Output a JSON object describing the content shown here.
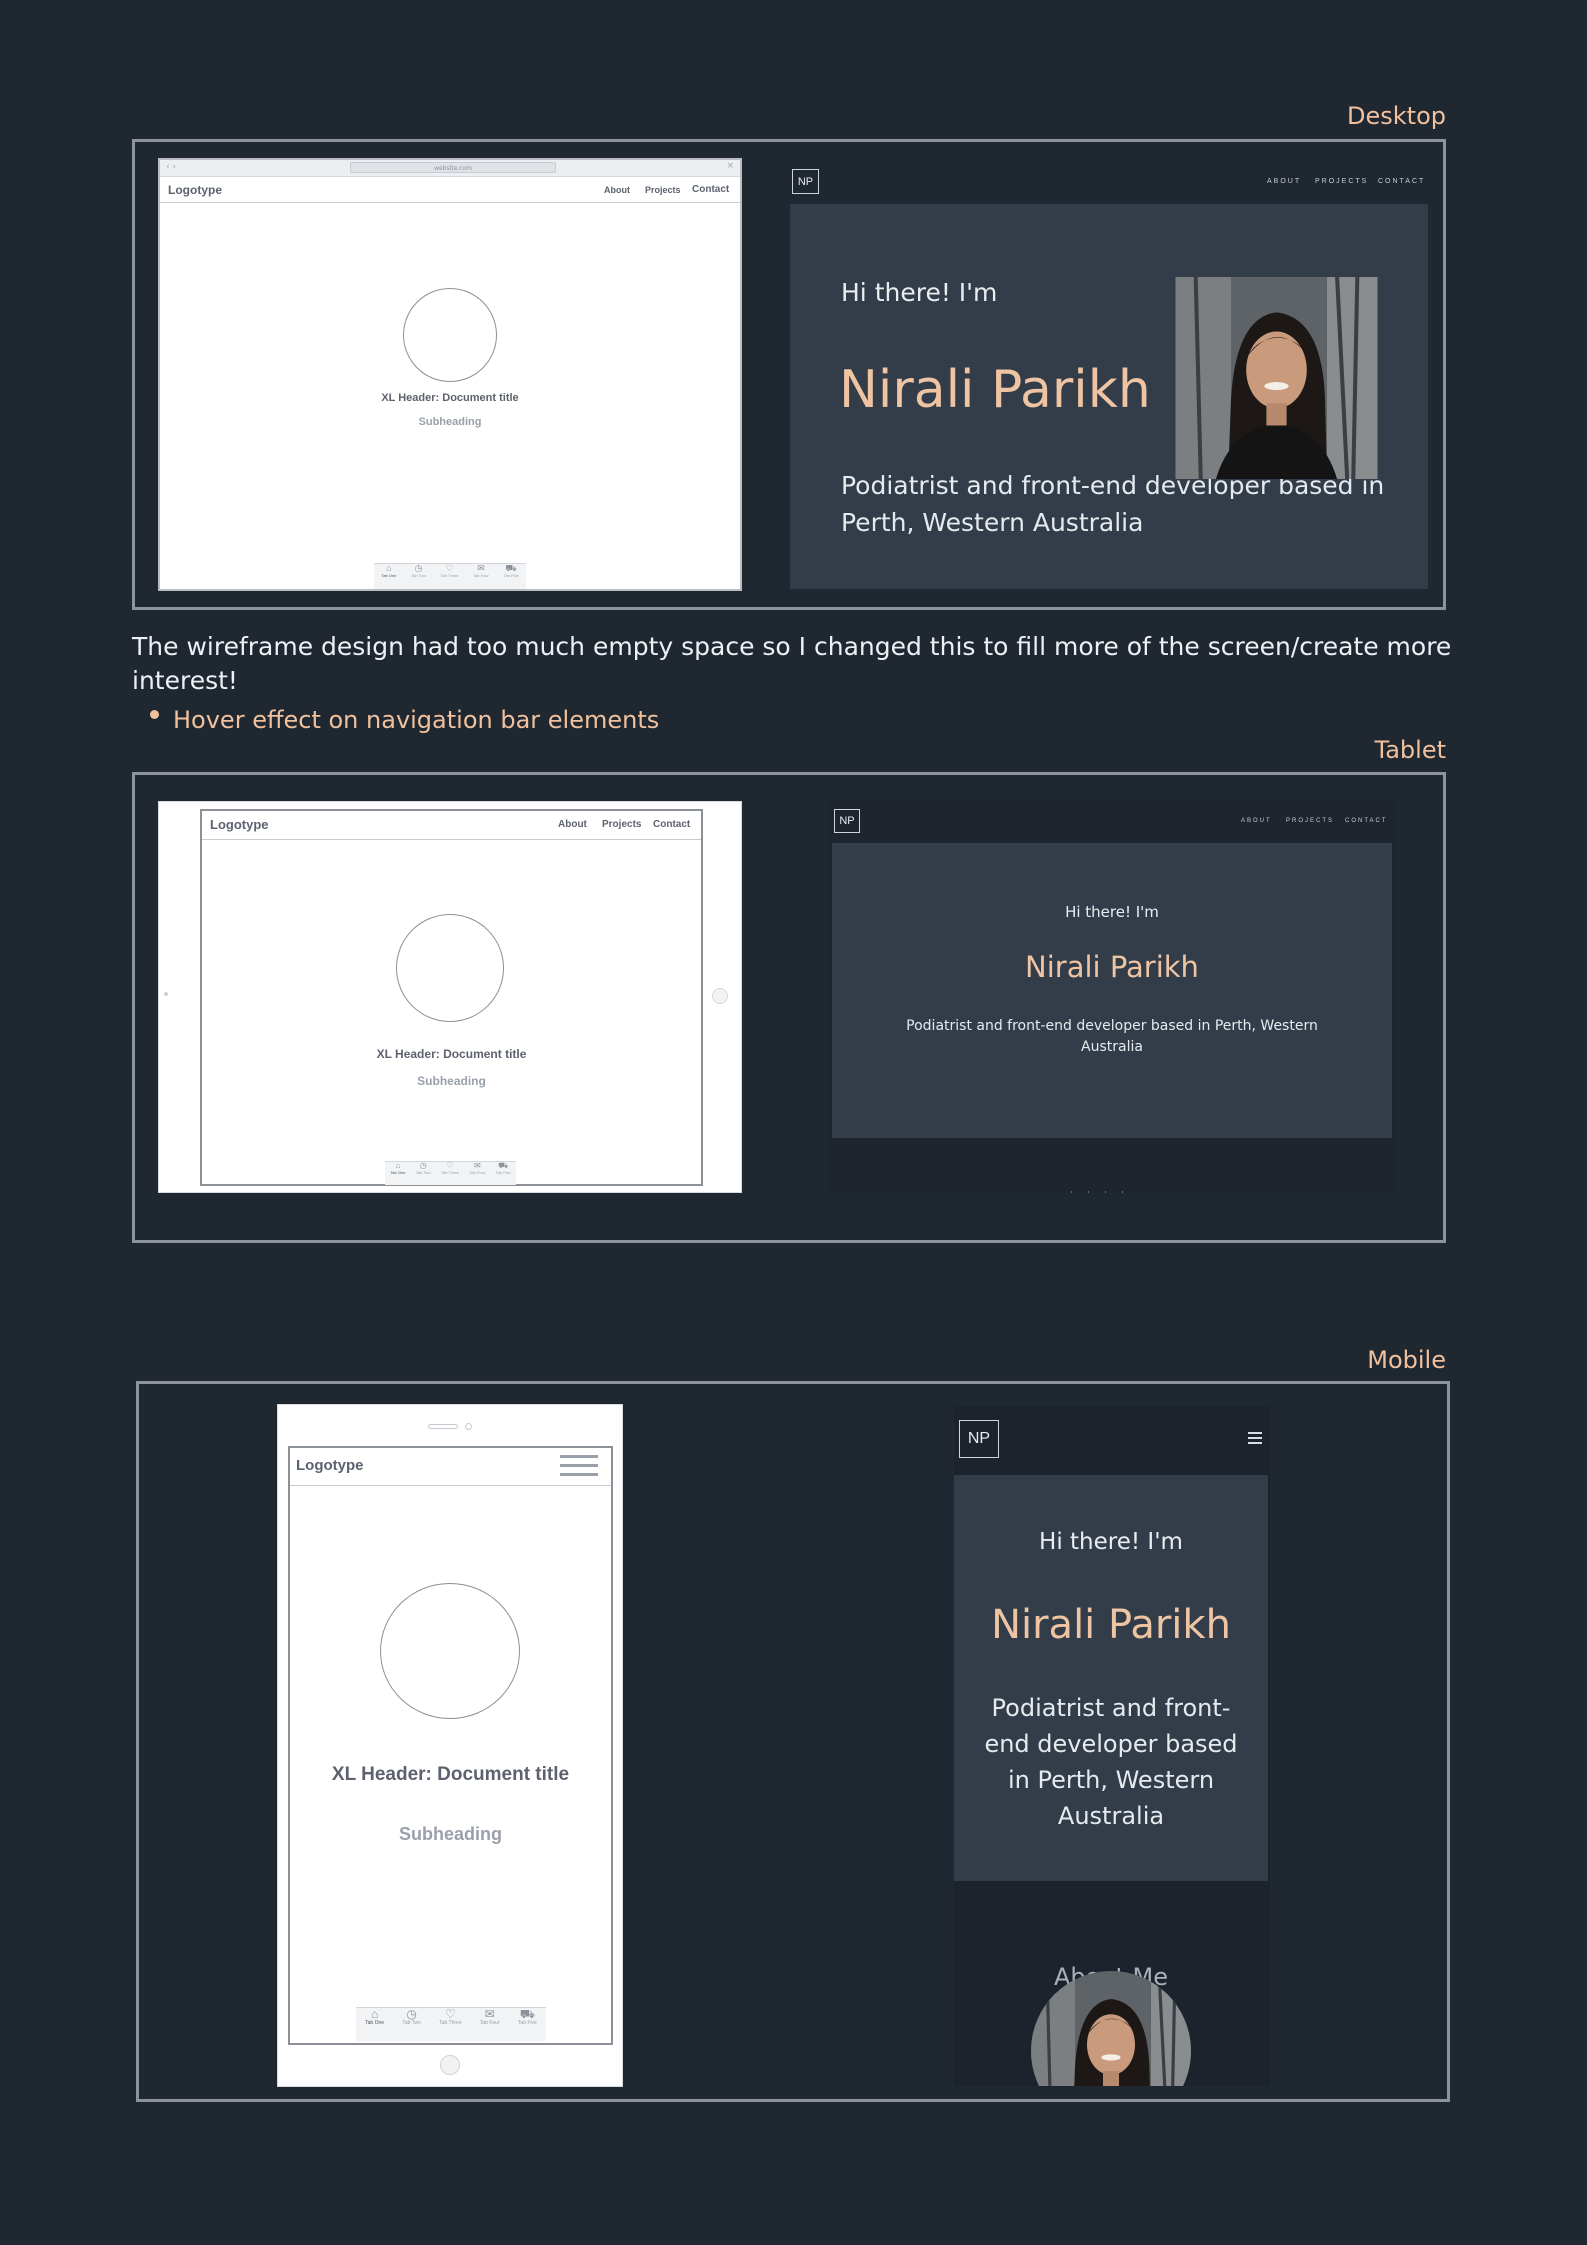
{
  "sections": {
    "desktop": "Desktop",
    "tablet": "Tablet",
    "mobile": "Mobile"
  },
  "wireframe": {
    "logotype": "Logotype",
    "url": "website.com",
    "nav": [
      "About",
      "Projects",
      "Contact"
    ],
    "title": "XL Header: Document title",
    "subheading": "Subheading",
    "tabs": [
      "Tab One",
      "Tab Two",
      "Tab Three",
      "Tab Four",
      "Tab Five"
    ]
  },
  "site": {
    "logo": "NP",
    "nav": [
      "ABOUT",
      "PROJECTS",
      "CONTACT"
    ],
    "greeting": "Hi there! I'm",
    "name": "Nirali Parikh",
    "description": "Podiatrist and front-end developer based in Perth, Western Australia",
    "about_heading": "About Me",
    "menu_icon": "hamburger-menu-icon"
  },
  "notes": {
    "desktop_note": "The wireframe design had too much empty space so I changed this to fill more of the screen/create more interest!",
    "bullets": [
      "Hover effect on navigation bar elements"
    ]
  },
  "colors": {
    "background": "#1f2731",
    "accent": "#f0c19c",
    "hero": "#323d49",
    "frame": "#8d939a"
  }
}
